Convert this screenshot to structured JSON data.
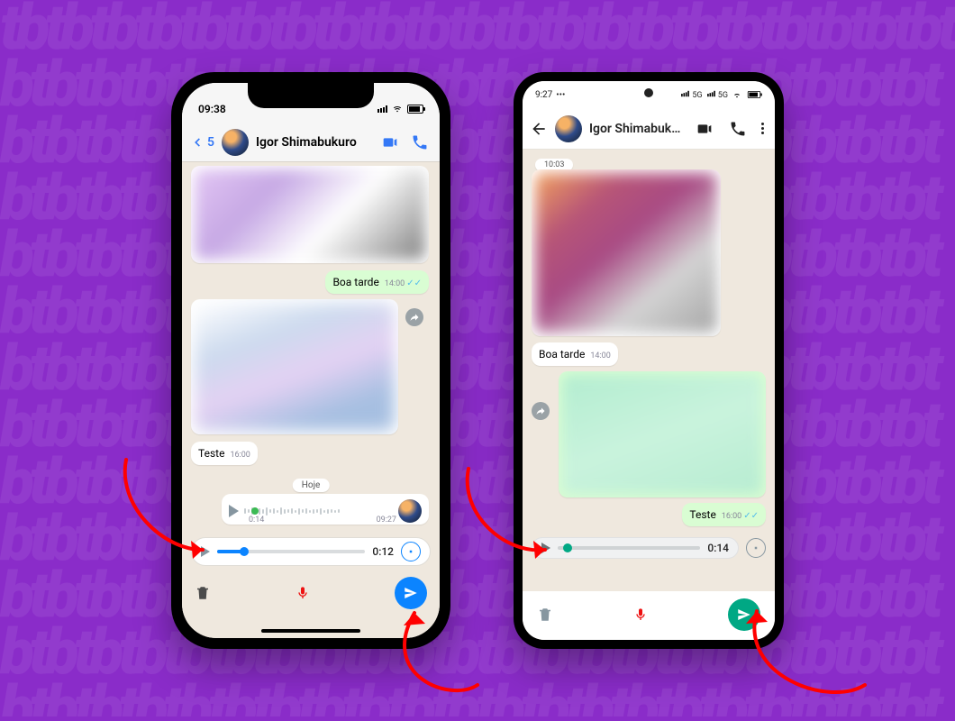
{
  "colors": {
    "background": "#8a2cc9",
    "ios_accent": "#3478f6",
    "ios_send": "#0b84ff",
    "android_send": "#00a884",
    "record_accent_ios": "#0b84ff",
    "record_accent_android": "#00a884",
    "danger": "#e11"
  },
  "ios": {
    "status": {
      "time": "09:38"
    },
    "header": {
      "back_count": "5",
      "contact_name": "Igor Shimabukuro"
    },
    "chat": {
      "msg_boa_tarde": {
        "text": "Boa tarde",
        "time": "14:00"
      },
      "msg_teste": {
        "text": "Teste",
        "time": "16:00"
      },
      "date_pill": "Hoje",
      "voice_sent": {
        "duration": "0:14",
        "time": "09:27"
      }
    },
    "recorder": {
      "time": "0:12"
    }
  },
  "android": {
    "status": {
      "time": "9:27",
      "net1": "5G",
      "net2": "5G"
    },
    "header": {
      "contact_name": "Igor Shimabukuro"
    },
    "chat": {
      "prev_time_pill": "10:03",
      "msg_boa_tarde": {
        "text": "Boa tarde",
        "time": "14:00"
      },
      "msg_teste": {
        "text": "Teste",
        "time": "16:00"
      }
    },
    "recorder": {
      "time": "0:14"
    }
  }
}
